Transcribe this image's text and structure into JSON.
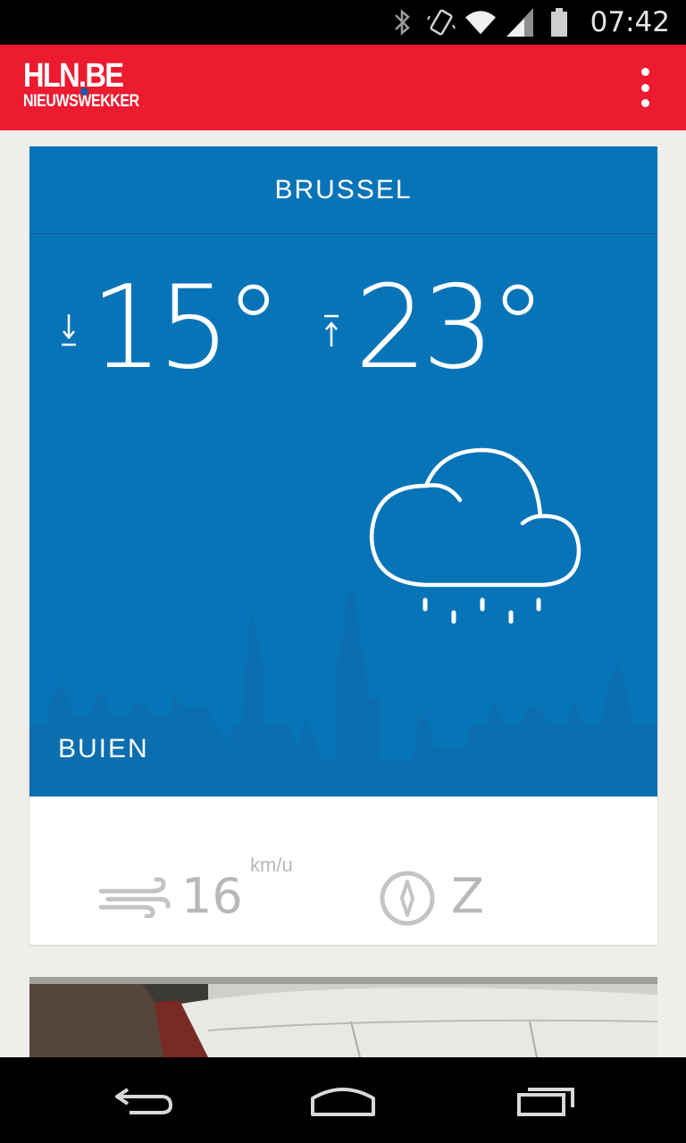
{
  "status_bar": {
    "time": "07:42",
    "icons": [
      "bluetooth-icon",
      "vibrate-icon",
      "wifi-icon",
      "cell-signal-icon",
      "battery-icon"
    ]
  },
  "app_bar": {
    "logo_line1": "HLN.BE",
    "logo_line2": "NIEUWSWEKKER",
    "menu_icon": "overflow-menu-icon",
    "colors": {
      "bar": "#ec1b2f",
      "logo_dot": "#1e5aa8"
    }
  },
  "weather": {
    "city": "BRUSSEL",
    "temp_min": "15°",
    "temp_max": "23°",
    "condition": "BUIEN",
    "condition_icon": "cloud-rain-icon",
    "wind_speed": "16",
    "wind_unit": "km/u",
    "wind_direction": "Z",
    "colors": {
      "card": "#0874b8",
      "muted": "#b8b8b8"
    }
  },
  "nav_bar": {
    "buttons": [
      "back-icon",
      "home-icon",
      "recents-icon"
    ]
  }
}
